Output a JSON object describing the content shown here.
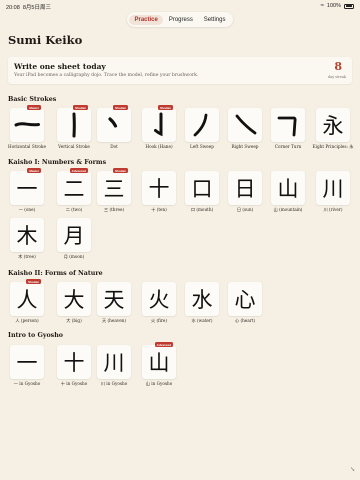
{
  "status_bar": {
    "time": "20:08",
    "date": "8月5日周三",
    "battery": "100%"
  },
  "tabs": [
    {
      "label": "Practice",
      "active": true
    },
    {
      "label": "Progress",
      "active": false
    },
    {
      "label": "Settings",
      "active": false
    }
  ],
  "app_title": "Sumi Keiko",
  "hero": {
    "title": "Write one sheet today",
    "subtitle": "Your iPad becomes a calligraphy dojo. Trace the model, refine your brushwork.",
    "streak_value": "8",
    "streak_label": "day streak"
  },
  "sections": [
    {
      "title": "Basic Strokes",
      "items": [
        {
          "glyph": "stroke-horizontal",
          "label": "Horizontal Stroke",
          "badge": "Master"
        },
        {
          "glyph": "stroke-vertical",
          "label": "Vertical Stroke",
          "badge": "Shodan"
        },
        {
          "glyph": "stroke-dot",
          "label": "Dot",
          "badge": "Shodan"
        },
        {
          "glyph": "stroke-hook",
          "label": "Hook (Hane)",
          "badge": "Shodan"
        },
        {
          "glyph": "stroke-left-sweep",
          "label": "Left Sweep",
          "badge": ""
        },
        {
          "glyph": "stroke-right-sweep",
          "label": "Right Sweep",
          "badge": ""
        },
        {
          "glyph": "stroke-corner-turn",
          "label": "Corner Turn",
          "badge": ""
        },
        {
          "glyph": "永",
          "label": "Eight Principles: 永",
          "badge": ""
        }
      ]
    },
    {
      "title": "Kaisho I: Numbers & Forms",
      "items": [
        {
          "glyph": "一",
          "label": "一 (one)",
          "badge": "Master"
        },
        {
          "glyph": "二",
          "label": "二 (two)",
          "badge": "Advanced"
        },
        {
          "glyph": "三",
          "label": "三 (three)",
          "badge": "Shodan"
        },
        {
          "glyph": "十",
          "label": "十 (ten)",
          "badge": ""
        },
        {
          "glyph": "口",
          "label": "口 (mouth)",
          "badge": ""
        },
        {
          "glyph": "日",
          "label": "日 (sun)",
          "badge": ""
        },
        {
          "glyph": "山",
          "label": "山 (mountain)",
          "badge": ""
        },
        {
          "glyph": "川",
          "label": "川 (river)",
          "badge": ""
        },
        {
          "glyph": "木",
          "label": "木 (tree)",
          "badge": ""
        },
        {
          "glyph": "月",
          "label": "月 (moon)",
          "badge": ""
        }
      ]
    },
    {
      "title": "Kaisho II: Forms of Nature",
      "items": [
        {
          "glyph": "人",
          "label": "人 (person)",
          "badge": "Shodan"
        },
        {
          "glyph": "大",
          "label": "大 (big)",
          "badge": ""
        },
        {
          "glyph": "天",
          "label": "天 (heaven)",
          "badge": ""
        },
        {
          "glyph": "火",
          "label": "火 (fire)",
          "badge": ""
        },
        {
          "glyph": "水",
          "label": "水 (water)",
          "badge": ""
        },
        {
          "glyph": "心",
          "label": "心 (heart)",
          "badge": ""
        }
      ]
    },
    {
      "title": "Intro to Gyosho",
      "items": [
        {
          "glyph": "一",
          "label": "一 in Gyosho",
          "badge": ""
        },
        {
          "glyph": "十",
          "label": "十 in Gyosho",
          "badge": ""
        },
        {
          "glyph": "川",
          "label": "川 in Gyosho",
          "badge": ""
        },
        {
          "glyph": "山",
          "label": "山 in Gyosho",
          "badge": "Advanced"
        }
      ]
    }
  ],
  "colors": {
    "accent": "#b0322a",
    "badge": "#bf3b30",
    "streak": "#b5432e",
    "background": "#f6f0e4"
  }
}
